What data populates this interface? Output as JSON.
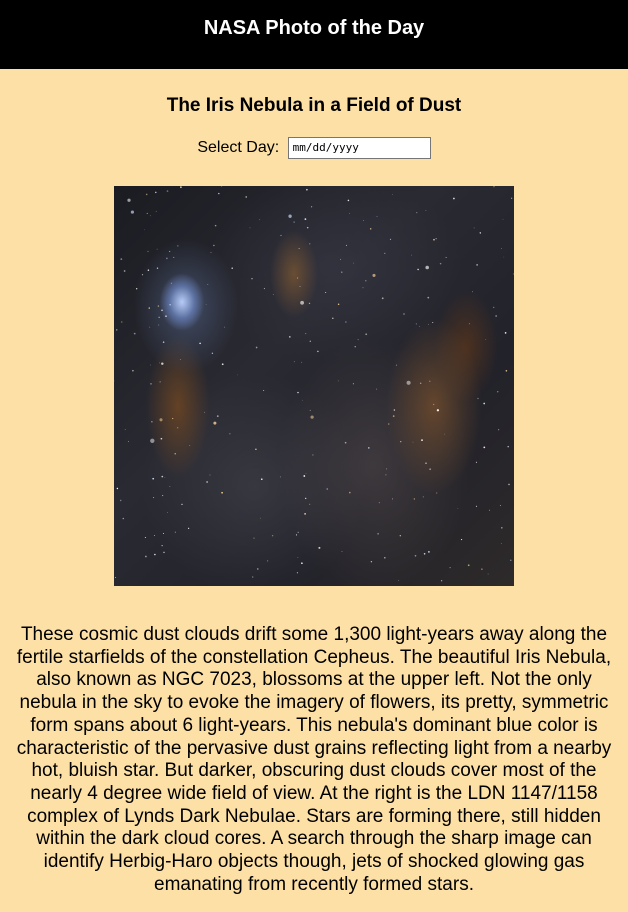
{
  "header": {
    "title": "NASA Photo of the Day"
  },
  "apod": {
    "title": "The Iris Nebula in a Field of Dust",
    "date_picker": {
      "label": "Select Day:",
      "value": "mm/dd/yyyy"
    },
    "image_icon": "nebula-photo",
    "description": "These cosmic dust clouds drift some 1,300 light-years away along the fertile starfields of the constellation Cepheus. The beautiful Iris Nebula, also known as NGC 7023, blossoms at the upper left. Not the only nebula in the sky to evoke the imagery of flowers, its pretty, symmetric form spans about 6 light-years. This nebula's dominant blue color is characteristic of the pervasive dust grains reflecting light from a nearby hot, bluish star. But darker, obscuring dust clouds cover most of the nearly 4 degree wide field of view. At the right is the LDN 1147/1158 complex of Lynds Dark Nebulae. Stars are forming there, still hidden within the dark cloud cores. A search through the sharp image can identify Herbig-Haro objects though, jets of shocked glowing gas emanating from recently formed stars."
  },
  "colors": {
    "page_background": "#fde0a6",
    "header_background": "#000000",
    "header_text": "#ffffff"
  }
}
